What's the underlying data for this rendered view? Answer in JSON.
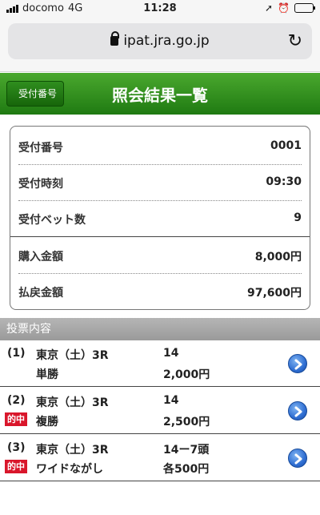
{
  "status_bar": {
    "carrier": "docomo",
    "network": "4G",
    "time": "11:28"
  },
  "browser": {
    "url": "ipat.jra.go.jp"
  },
  "header": {
    "back_label": "受付番号",
    "title": "照会結果一覧"
  },
  "summary": {
    "rows": [
      {
        "label": "受付番号",
        "value": "0001"
      },
      {
        "label": "受付時刻",
        "value": "09:30"
      },
      {
        "label": "受付ベット数",
        "value": "9"
      },
      {
        "label": "購入金額",
        "value": "8,000円"
      },
      {
        "label": "払戻金額",
        "value": "97,600円"
      }
    ]
  },
  "bets_section_title": "投票内容",
  "bets": [
    {
      "num": "(1)",
      "race": "東京（土）3R",
      "type": "単勝",
      "horse": "14",
      "amount": "2,000円",
      "hit": ""
    },
    {
      "num": "(2)",
      "race": "東京（土）3R",
      "type": "複勝",
      "horse": "14",
      "amount": "2,500円",
      "hit": "的中"
    },
    {
      "num": "(3)",
      "race": "東京（土）3R",
      "type": "ワイドながし",
      "horse": "14ー7頭",
      "amount": "各500円",
      "hit": "的中"
    }
  ],
  "colors": {
    "header_green": "#2e8f1c",
    "hit_red": "#d9162b",
    "arrow_blue": "#2f6ed2"
  }
}
